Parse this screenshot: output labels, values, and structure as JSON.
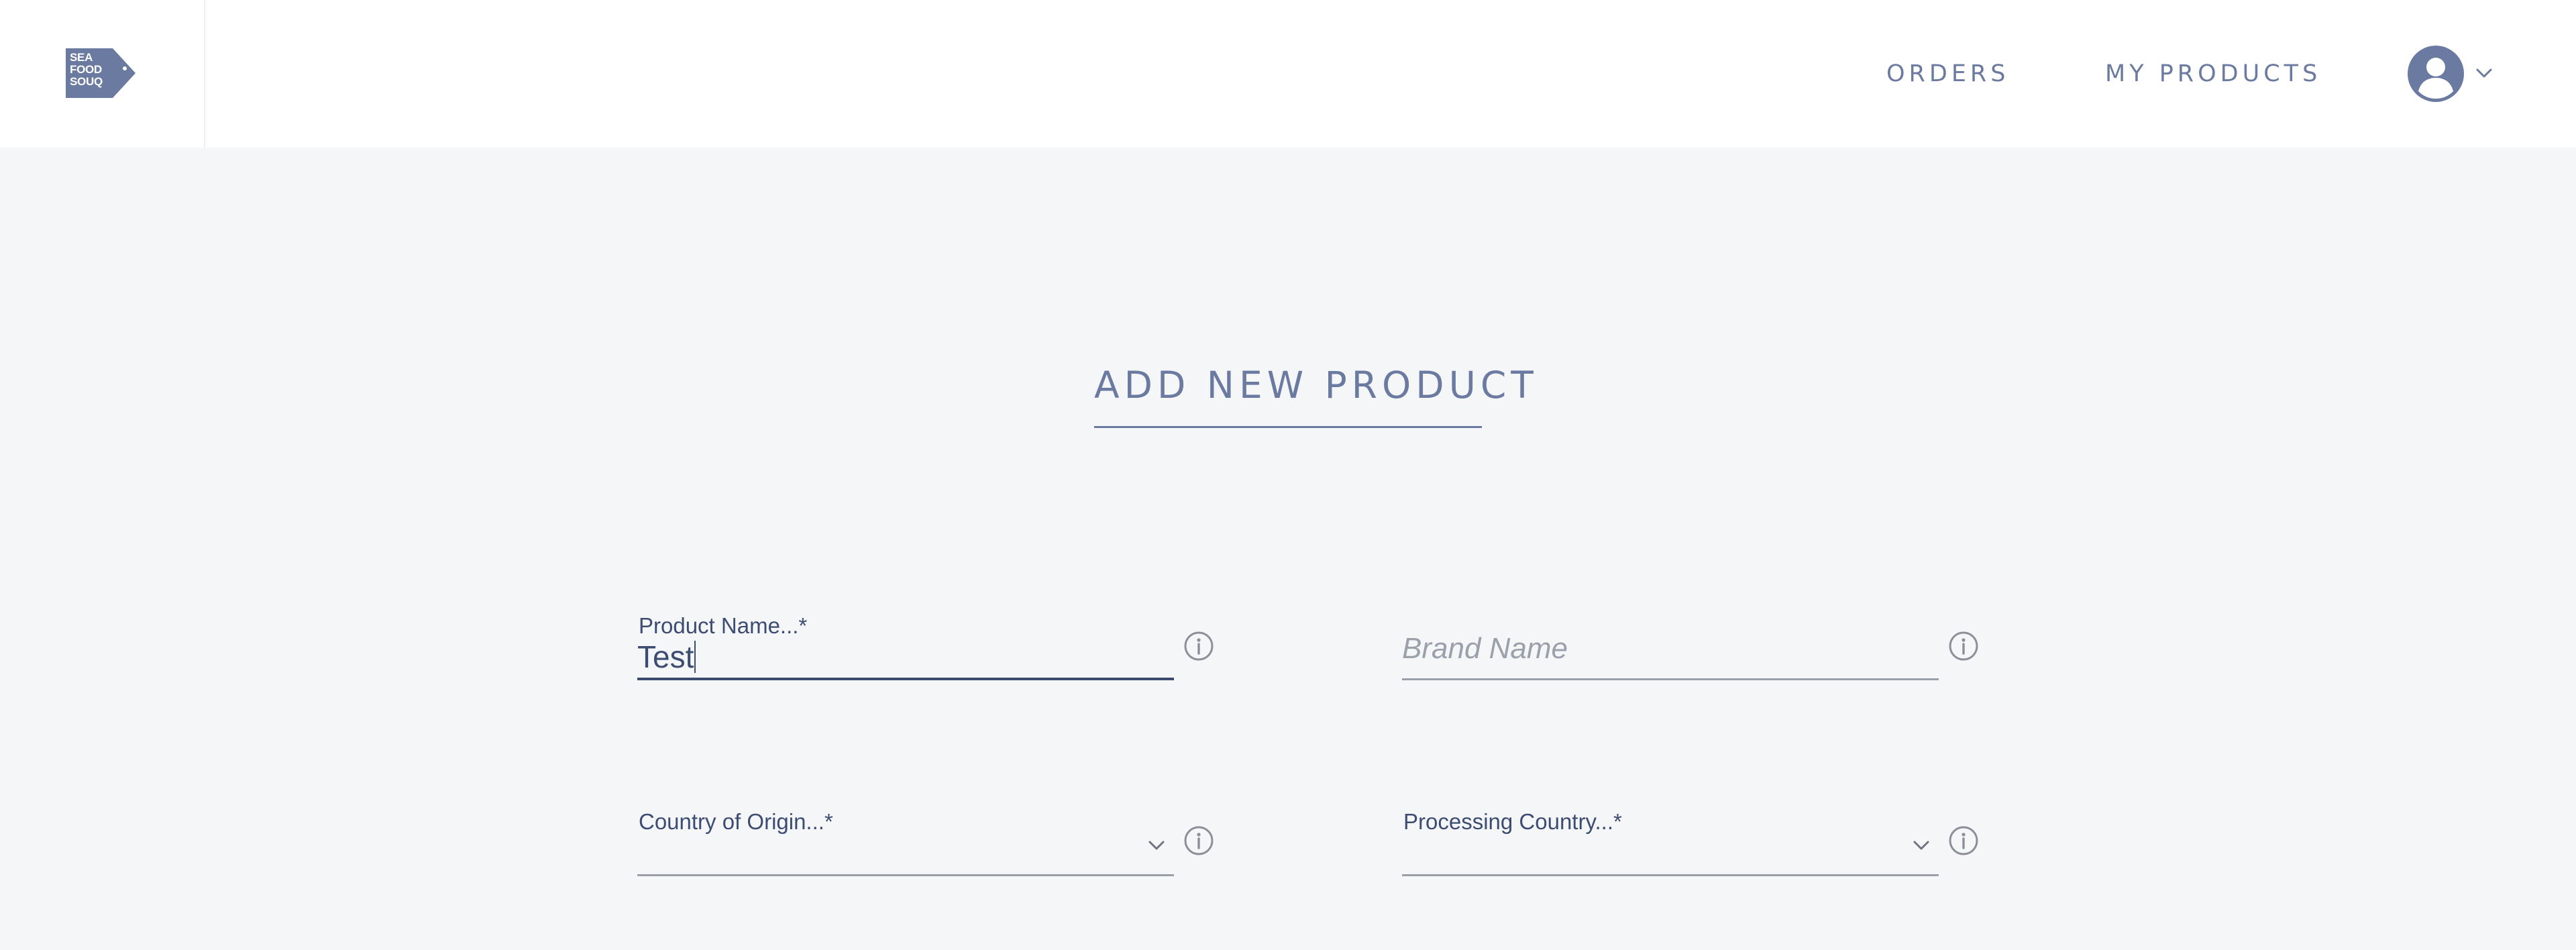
{
  "header": {
    "logo": {
      "icon": "seafood-souq-logo",
      "lines": [
        "SEA",
        "FOOD",
        "SOUQ"
      ],
      "color": "#6b7aa0"
    },
    "nav": {
      "orders": "ORDERS",
      "my_products": "MY PRODUCTS"
    },
    "user_menu": {
      "avatar_icon": "user-avatar-icon",
      "caret_icon": "chevron-down-icon"
    }
  },
  "page": {
    "title": "ADD NEW PRODUCT"
  },
  "form": {
    "product_name": {
      "label": "Product Name...*",
      "value": "Test",
      "info_icon": "info-icon"
    },
    "brand_name": {
      "placeholder": "Brand Name",
      "value": "",
      "info_icon": "info-icon"
    },
    "country_of_origin": {
      "label": "Country of Origin...*",
      "value": "",
      "info_icon": "info-icon",
      "caret_icon": "chevron-down-icon"
    },
    "processing_country": {
      "label": "Processing Country...*",
      "value": "",
      "info_icon": "info-icon",
      "caret_icon": "chevron-down-icon"
    }
  },
  "colors": {
    "accent": "#6b7aa0",
    "text": "#3d4c72",
    "background": "#f5f6f8",
    "header": "#ffffff"
  }
}
